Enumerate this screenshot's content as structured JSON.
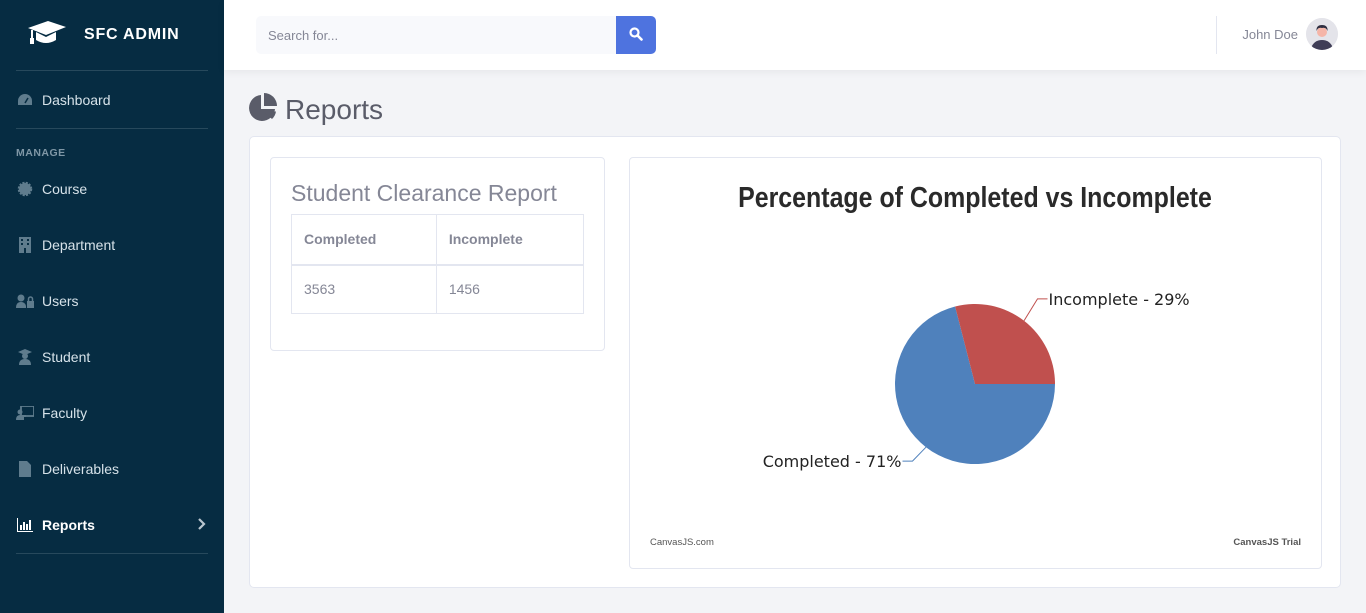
{
  "sidebar": {
    "brand": "SFC ADMIN",
    "dashboard": "Dashboard",
    "heading": "MANAGE",
    "items": [
      {
        "label": "Course",
        "icon": "cog-icon"
      },
      {
        "label": "Department",
        "icon": "building-icon"
      },
      {
        "label": "Users",
        "icon": "user-lock-icon"
      },
      {
        "label": "Student",
        "icon": "user-graduate-icon"
      },
      {
        "label": "Faculty",
        "icon": "chalkboard-teacher-icon"
      },
      {
        "label": "Deliverables",
        "icon": "file-icon"
      },
      {
        "label": "Reports",
        "icon": "chart-bar-icon",
        "active": true
      }
    ]
  },
  "topbar": {
    "search_placeholder": "Search for...",
    "search_value": "",
    "user_name": "John Doe"
  },
  "page": {
    "title": "Reports"
  },
  "report": {
    "title": "Student Clearance Report",
    "columns": [
      "Completed",
      "Incomplete"
    ],
    "rows": [
      [
        "3563",
        "1456"
      ]
    ]
  },
  "colors": {
    "sidebar_bg": "#062c42",
    "accent": "#4e73df",
    "completed": "#4f81bc",
    "incomplete": "#c0504e"
  },
  "chart_data": {
    "type": "pie",
    "title": "Percentage of Completed vs Incomplete",
    "categories": [
      "Completed",
      "Incomplete"
    ],
    "values": [
      71,
      29
    ],
    "labels": [
      "Completed - 71%",
      "Incomplete - 29%"
    ],
    "colors": [
      "#4f81bc",
      "#c0504e"
    ],
    "footer_left": "CanvasJS.com",
    "footer_right": "CanvasJS Trial"
  }
}
